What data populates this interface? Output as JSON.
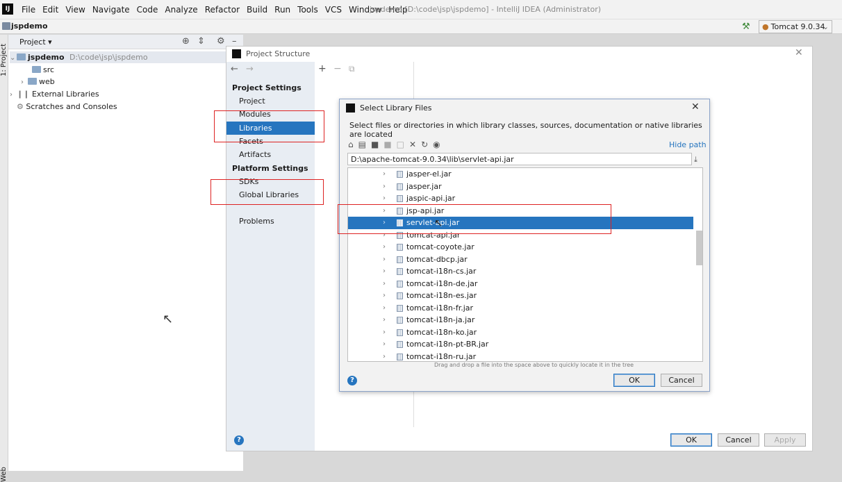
{
  "menubar": {
    "logo": "IJ",
    "items": [
      "File",
      "Edit",
      "View",
      "Navigate",
      "Code",
      "Analyze",
      "Refactor",
      "Build",
      "Run",
      "Tools",
      "VCS",
      "Window",
      "Help"
    ],
    "window_title": "jspdemo [D:\\code\\jsp\\jspdemo] - IntelliJ IDEA (Administrator)"
  },
  "navbar": {
    "breadcrumb": "jspdemo",
    "run_config": "Tomcat 9.0.34"
  },
  "left_stripe": {
    "top_tab": "1: Project",
    "bottom_tab": "Web"
  },
  "project_panel": {
    "header": "Project",
    "tree": [
      {
        "name": "jspdemo",
        "path": "D:\\code\\jsp\\jspdemo"
      },
      {
        "name": "src"
      },
      {
        "name": "web"
      },
      {
        "name": "External Libraries"
      },
      {
        "name": "Scratches and Consoles"
      }
    ]
  },
  "project_structure": {
    "title": "Project Structure",
    "project_settings_heading": "Project Settings",
    "project_settings": [
      "Project",
      "Modules",
      "Libraries",
      "Facets",
      "Artifacts"
    ],
    "platform_settings_heading": "Platform Settings",
    "platform_settings": [
      "SDKs",
      "Global Libraries"
    ],
    "problems": "Problems",
    "selected_item": "Libraries",
    "buttons": {
      "ok": "OK",
      "cancel": "Cancel",
      "apply": "Apply"
    }
  },
  "select_library": {
    "title": "Select Library Files",
    "description": "Select files or directories in which library classes, sources, documentation or native libraries are located",
    "hide_path": "Hide path",
    "path_value": "D:\\apache-tomcat-9.0.34\\lib\\servlet-api.jar",
    "files": [
      "jasper-el.jar",
      "jasper.jar",
      "jaspic-api.jar",
      "jsp-api.jar",
      "servlet-api.jar",
      "tomcat-api.jar",
      "tomcat-coyote.jar",
      "tomcat-dbcp.jar",
      "tomcat-i18n-cs.jar",
      "tomcat-i18n-de.jar",
      "tomcat-i18n-es.jar",
      "tomcat-i18n-fr.jar",
      "tomcat-i18n-ja.jar",
      "tomcat-i18n-ko.jar",
      "tomcat-i18n-pt-BR.jar",
      "tomcat-i18n-ru.jar"
    ],
    "selected_file": "servlet-api.jar",
    "hint": "Drag and drop a file into the space above to quickly locate it in the tree",
    "buttons": {
      "ok": "OK",
      "cancel": "Cancel"
    }
  },
  "colors": {
    "selection": "#2675bf",
    "annotation": "#dd2222"
  }
}
